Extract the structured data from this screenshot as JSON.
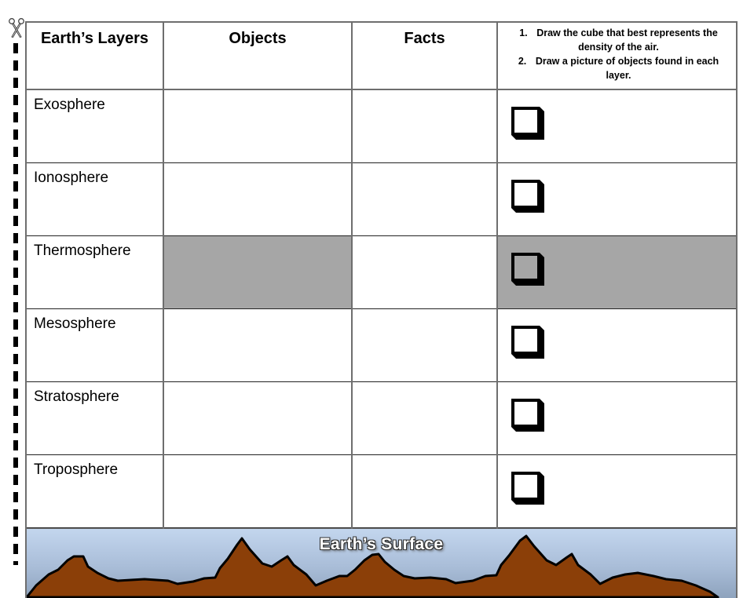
{
  "worksheet": {
    "headers": {
      "layers": "Earth’s Layers",
      "objects": "Objects",
      "facts": "Facts"
    },
    "instructions": [
      {
        "num": "1.",
        "text": "Draw the cube that best represents the density of the air."
      },
      {
        "num": "2.",
        "text": "Draw a picture of objects found in each layer."
      }
    ],
    "rows": [
      {
        "layer": "Exosphere",
        "shaded": false
      },
      {
        "layer": "Ionosphere",
        "shaded": false
      },
      {
        "layer": "Thermosphere",
        "shaded": true
      },
      {
        "layer": "Mesosphere",
        "shaded": false
      },
      {
        "layer": "Stratosphere",
        "shaded": false
      },
      {
        "layer": "Troposphere",
        "shaded": false
      }
    ],
    "surface_label": "Earth’s Surface",
    "icons": {
      "cut_marker": "scissors-icon",
      "density_box": "cube-icon"
    },
    "colors": {
      "shaded_cell": "#a6a6a6",
      "mountain_fill": "#8b3f08",
      "sky_top": "#c3d6ee",
      "sky_bottom": "#8ea3bd"
    }
  }
}
